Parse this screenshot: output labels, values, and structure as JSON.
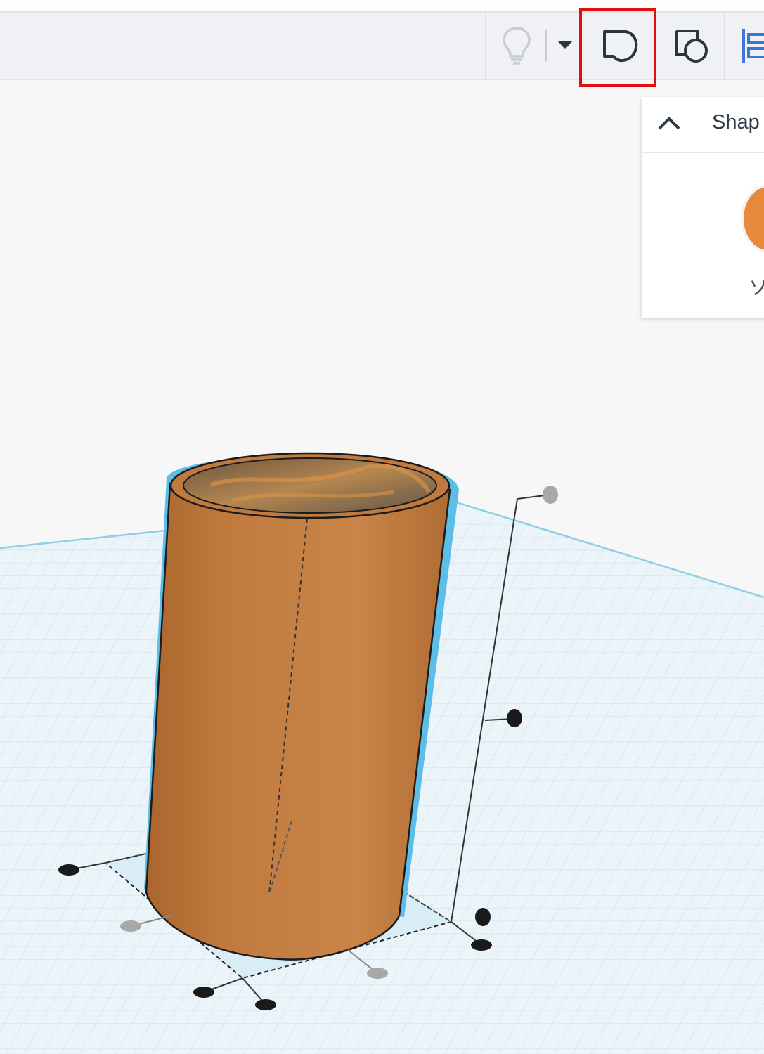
{
  "toolbar": {
    "buttons": [
      {
        "name": "hint-lightbulb",
        "icon": "lightbulb-icon",
        "state": "disabled"
      },
      {
        "name": "dropdown",
        "icon": "caret-down-icon"
      },
      {
        "name": "group",
        "icon": "group-shapes-icon",
        "highlighted": true
      },
      {
        "name": "ungroup",
        "icon": "ungroup-shapes-icon"
      },
      {
        "name": "align",
        "icon": "align-icon"
      }
    ]
  },
  "shape_panel": {
    "title": "Shap",
    "collapse_icon": "chevron-up-icon",
    "swatch_color": "#e6893a",
    "swatch_label": "ソ"
  },
  "colors": {
    "highlight": "#e01010",
    "object_fill": "#c07a3e",
    "selection_outline": "#5bbde8",
    "grid_line": "#cfe3ee",
    "workplane": "#e8f3f9"
  }
}
